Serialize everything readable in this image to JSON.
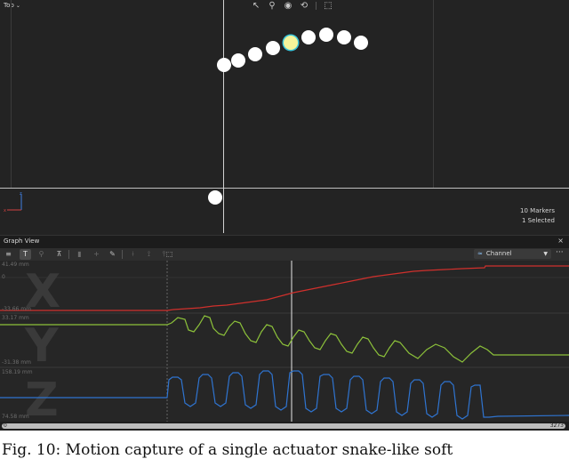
{
  "viewport": {
    "view_label": "Top",
    "marker_count": "10 Markers",
    "selected_count": "1 Selected",
    "tools": [
      "select-icon",
      "zoom-icon",
      "eye-icon",
      "lasso-icon",
      "box-select-icon"
    ]
  },
  "graph_view": {
    "title": "Graph View",
    "close_glyph": "×",
    "channel_label": "Channel",
    "more_glyph": "···",
    "toolbar_icons": [
      "list-icon",
      "text-cursor-icon",
      "zoom-icon",
      "fit-icon",
      "trash-icon",
      "crosshair-icon",
      "pen-icon",
      "split-icon",
      "merge-icon",
      "cut-icon",
      "box-select-icon"
    ],
    "scroll_start": "0",
    "scroll_end": "3273",
    "accent_colors": {
      "x": "#d0302c",
      "y": "#8cc13a",
      "z": "#2f74d0"
    },
    "graphs": [
      {
        "axis_letter": "X",
        "top_label": "41.49 mm",
        "mid_label": "0",
        "bottom_label": "-33.66 mm"
      },
      {
        "axis_letter": "Y",
        "top_label": "33.17 mm",
        "bottom_label": "-31.38 mm"
      },
      {
        "axis_letter": "Z",
        "top_label": "158.19 mm",
        "bottom_label": "74.58 mm"
      }
    ]
  },
  "caption": "Fig. 10: Motion capture of a single actuator snake-like soft"
}
